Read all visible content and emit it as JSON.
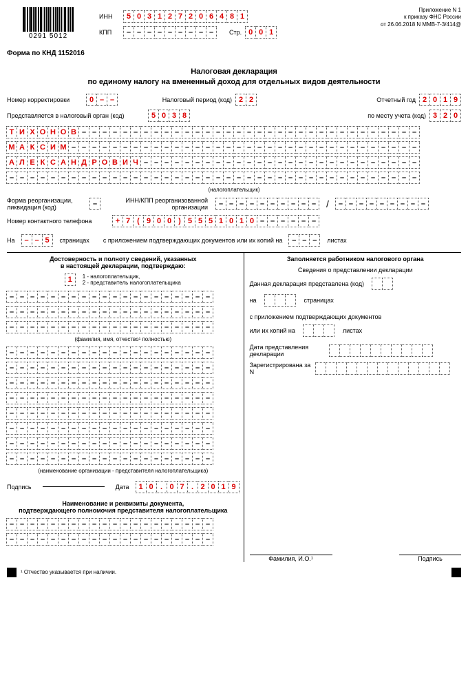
{
  "appendix": "Приложение N 1",
  "order_line": "к приказу ФНС России",
  "order_ref": "от 26.06.2018 N ММВ-7-3/414@",
  "barcode_num": "0291 5012",
  "inn_label": "ИНН",
  "inn": "503127206481",
  "kpp_label": "КПП",
  "str_label": "Стр.",
  "str": "001",
  "form_knd": "Форма по КНД 1152016",
  "title1": "Налоговая декларация",
  "title2": "по единому налогу на вмененный доход для отдельных видов деятельности",
  "corr_label": "Номер корректировки",
  "corr": "0--",
  "period_label": "Налоговый период (код)",
  "period": "22",
  "year_label": "Отчетный год",
  "year": "2019",
  "organ_label": "Представляется в налоговый орган (код)",
  "organ": "5038",
  "place_label": "по месту учета (код)",
  "place": "320",
  "surname": "ТИХОНОВ",
  "name": "МАКСИМ",
  "patronymic": "АЛЕКСАНДРОВИЧ",
  "taxpayer_note": "(налогоплательщик)",
  "reorg_form_label": "Форма реорганизации,\nликвидация (код)",
  "reorg_inn_label": "ИНН/КПП реорганизованной\nорганизации",
  "phone_label": "Номер контактного телефона",
  "phone": "+7(900)5551010",
  "pages_a": "На",
  "pages_b": "страницах",
  "pages": "--5",
  "att_label": "с приложением подтверждающих документов или их копий на",
  "sheets_label": "листах",
  "left": {
    "h1": "Достоверность и полноту сведений, указанных",
    "h2": "в настоящей декларации, подтверждаю:",
    "confirm": "1",
    "confirm_note1": "1 - налогоплательщик,",
    "confirm_note2": "2 - представитель налогоплательщика",
    "fio_note": "(фамилия, имя, отчество¹ полностью)",
    "org_note": "(наименование организации - представителя налогоплательщика)",
    "sign_label": "Подпись",
    "date_label": "Дата",
    "date": "10.07.2019",
    "doc_h1": "Наименование и реквизиты документа,",
    "doc_h2": "подтверждающего полномочия представителя налогоплательщика"
  },
  "right": {
    "h": "Заполняется работником налогового органа",
    "sub": "Сведения о представлении декларации",
    "l1a": "Данная декларация представлена (код)",
    "l2a": "на",
    "l2b": "страницах",
    "l3": "с приложением подтверждающих документов",
    "l4a": "или их копий на",
    "l4b": "листах",
    "l5": "Дата представления декларации",
    "l6": "Зарегистрирована за N",
    "fio": "Фамилия, И.О.¹",
    "sign": "Подпись"
  },
  "footnote": "¹ Отчество указывается при наличии."
}
